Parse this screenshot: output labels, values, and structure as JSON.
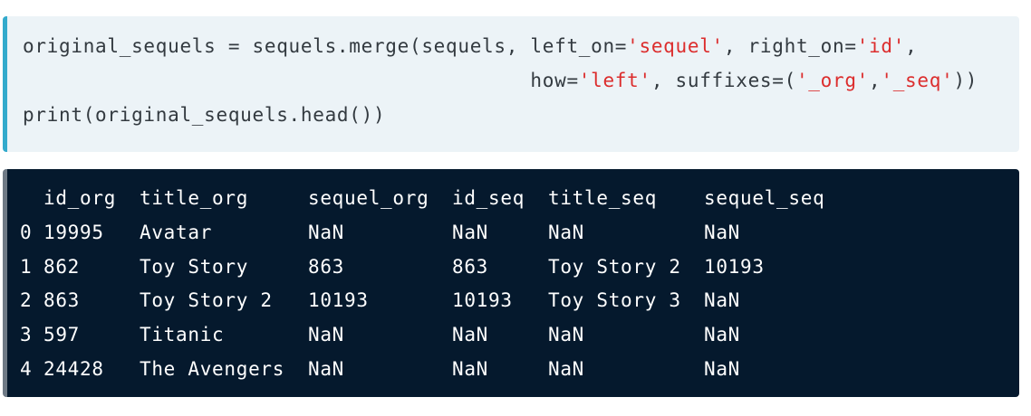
{
  "code": {
    "line1": {
      "p1": "original_sequels = sequels.merge(sequels, left_on=",
      "s1": "'sequel'",
      "p2": ", right_on=",
      "s2": "'id'",
      "p3": ","
    },
    "line2": {
      "p1": "                                          how=",
      "s1": "'left'",
      "p2": ", suffixes=(",
      "s2": "'_org'",
      "p3": ",",
      "s3": "'_seq'",
      "p4": "))"
    },
    "line3": "print(original_sequels.head())"
  },
  "colors": {
    "code_bg": "#ecf3f7",
    "code_border": "#33aacc",
    "string": "#dc2d2d",
    "output_bg": "#05192d",
    "output_border": "#6f7a86"
  },
  "output": {
    "header": [
      "",
      "id_org",
      "title_org",
      "sequel_org",
      "id_seq",
      "title_seq",
      "sequel_seq"
    ],
    "rows": [
      [
        "0",
        "19995",
        "Avatar",
        "NaN",
        "NaN",
        "NaN",
        "NaN"
      ],
      [
        "1",
        "862",
        "Toy Story",
        "863",
        "863",
        "Toy Story 2",
        "10193"
      ],
      [
        "2",
        "863",
        "Toy Story 2",
        "10193",
        "10193",
        "Toy Story 3",
        "NaN"
      ],
      [
        "3",
        "597",
        "Titanic",
        "NaN",
        "NaN",
        "NaN",
        "NaN"
      ],
      [
        "4",
        "24428",
        "The Avengers",
        "NaN",
        "NaN",
        "NaN",
        "NaN"
      ]
    ]
  }
}
